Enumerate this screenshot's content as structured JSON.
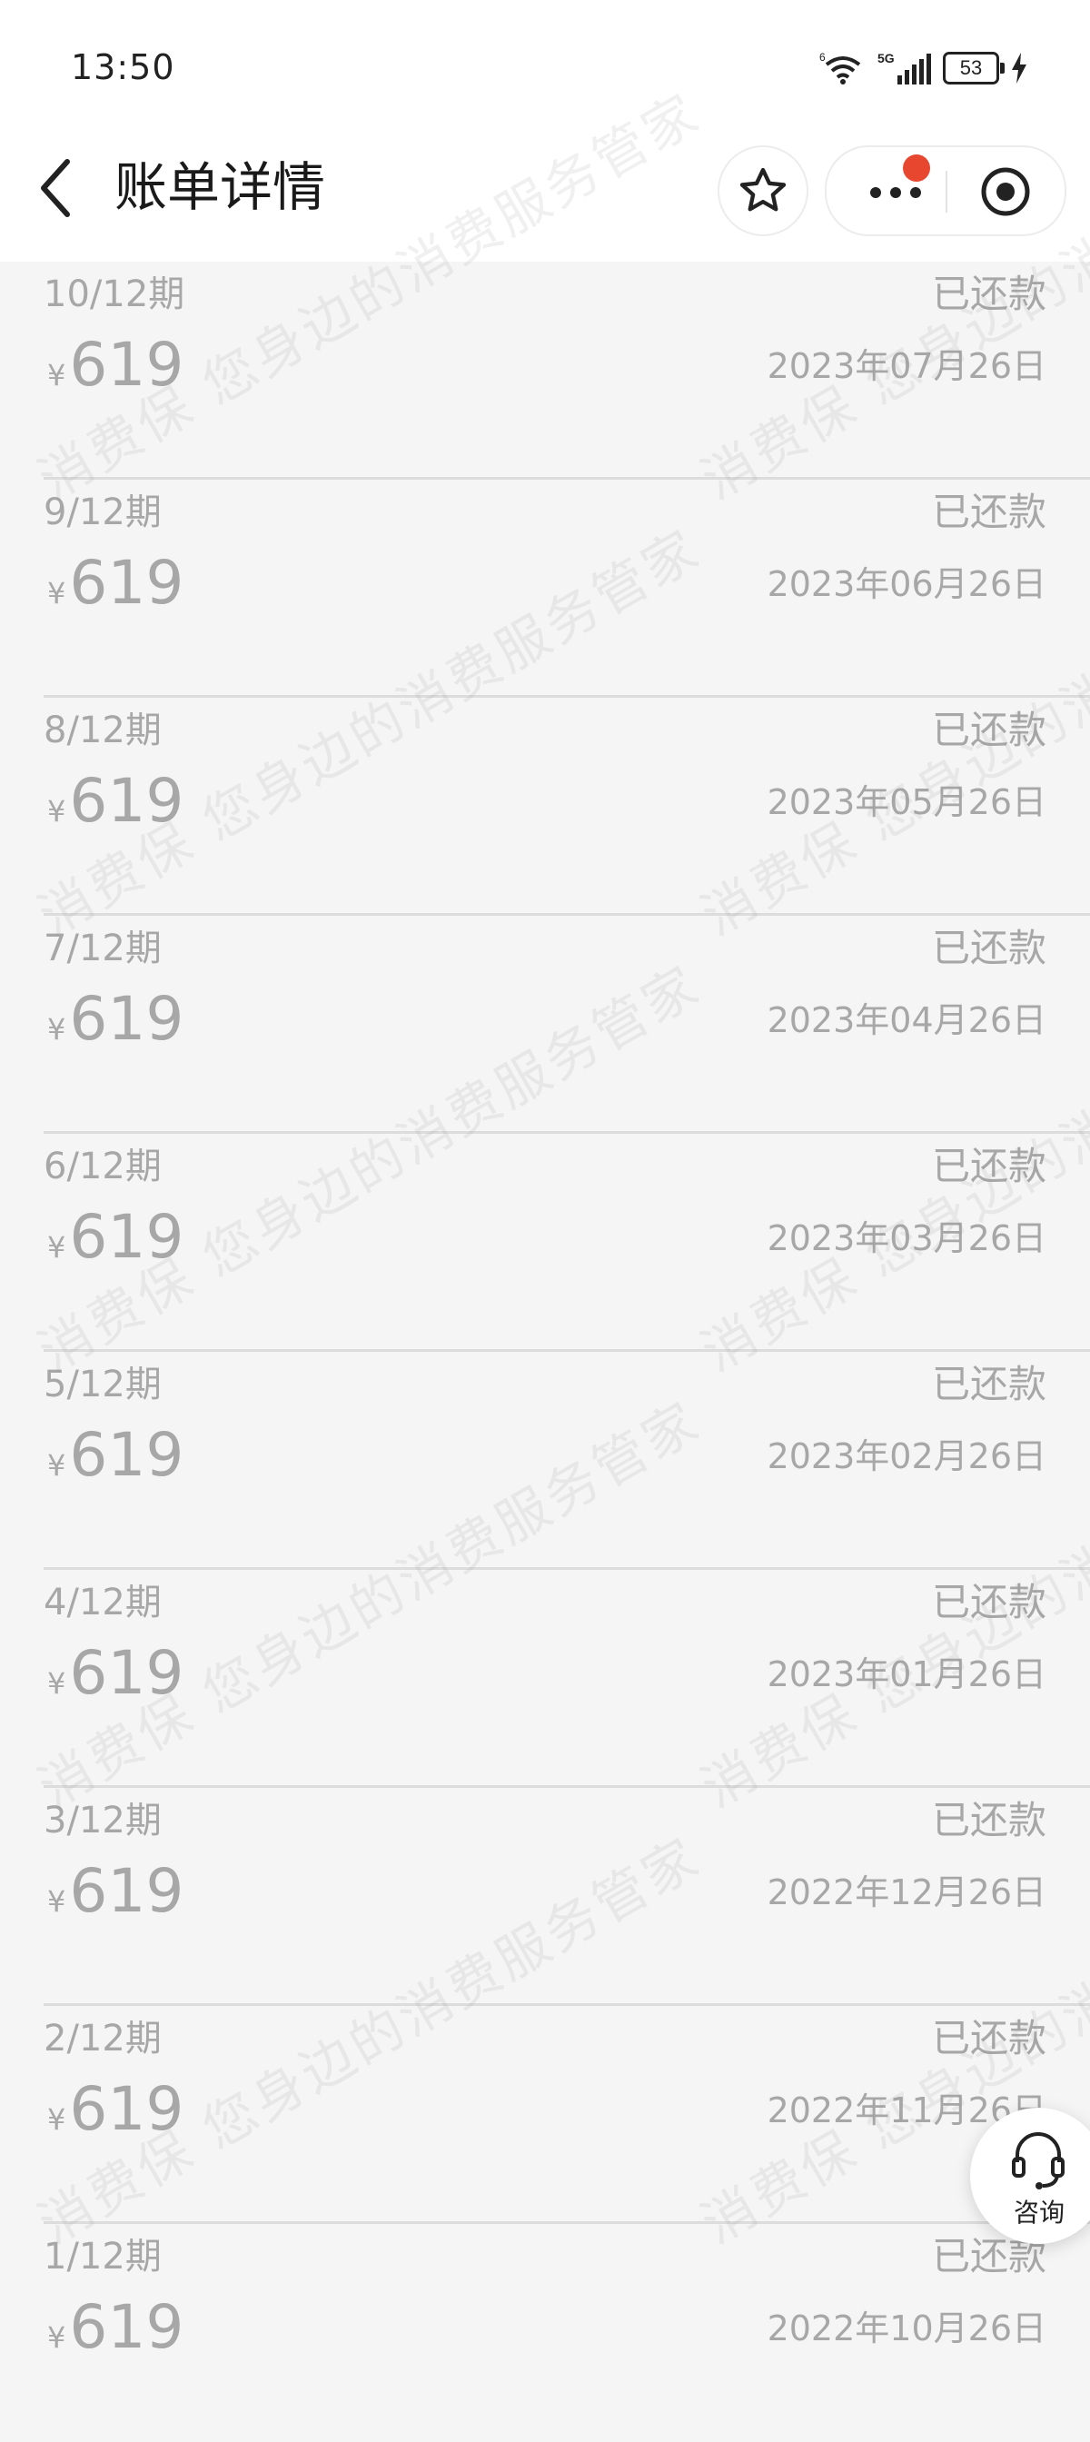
{
  "status_bar": {
    "time": "13:50",
    "battery": "53"
  },
  "nav": {
    "title": "账单详情"
  },
  "bills": [
    {
      "period": "10/12期",
      "amount": "619",
      "status": "已还款",
      "date": "2023年07月26日"
    },
    {
      "period": "9/12期",
      "amount": "619",
      "status": "已还款",
      "date": "2023年06月26日"
    },
    {
      "period": "8/12期",
      "amount": "619",
      "status": "已还款",
      "date": "2023年05月26日"
    },
    {
      "period": "7/12期",
      "amount": "619",
      "status": "已还款",
      "date": "2023年04月26日"
    },
    {
      "period": "6/12期",
      "amount": "619",
      "status": "已还款",
      "date": "2023年03月26日"
    },
    {
      "period": "5/12期",
      "amount": "619",
      "status": "已还款",
      "date": "2023年02月26日"
    },
    {
      "period": "4/12期",
      "amount": "619",
      "status": "已还款",
      "date": "2023年01月26日"
    },
    {
      "period": "3/12期",
      "amount": "619",
      "status": "已还款",
      "date": "2022年12月26日"
    },
    {
      "period": "2/12期",
      "amount": "619",
      "status": "已还款",
      "date": "2022年11月26日"
    },
    {
      "period": "1/12期",
      "amount": "619",
      "status": "已还款",
      "date": "2022年10月26日"
    }
  ],
  "currency_symbol": "¥",
  "consult": {
    "label": "咨询"
  },
  "watermark": {
    "text": "消费保 您身边的消费服务管家"
  },
  "colors": {
    "accent_dot": "#e8472f",
    "muted_text": "#a7a7a7",
    "background": "#f5f5f5"
  },
  "icons": [
    "back-icon",
    "star-icon",
    "more-icon",
    "target-icon",
    "headset-icon",
    "wifi-icon",
    "signal-icon",
    "battery-icon",
    "charging-icon"
  ]
}
